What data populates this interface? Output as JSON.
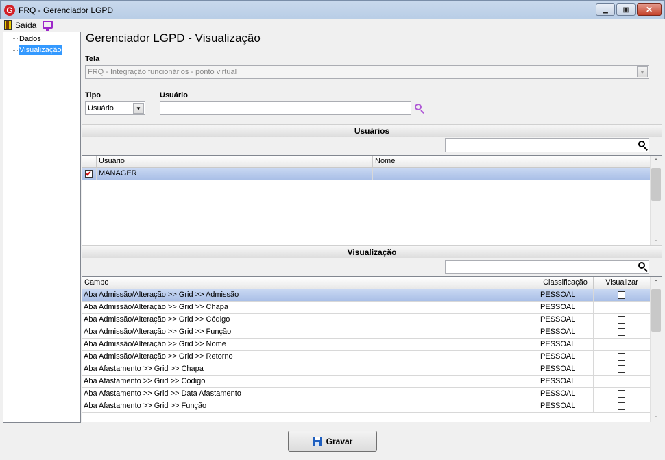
{
  "window": {
    "title": "FRQ - Gerenciador LGPD",
    "logo": "G"
  },
  "menu": {
    "exit_label": "Saída"
  },
  "tree": {
    "items": [
      "Dados",
      "Visualização"
    ]
  },
  "page_title": "Gerenciador LGPD - Visualização",
  "tela": {
    "label": "Tela",
    "value": "FRQ - Integração funcionários - ponto virtual"
  },
  "tipo": {
    "label": "Tipo",
    "value": "Usuário"
  },
  "usuario": {
    "label": "Usuário",
    "value": ""
  },
  "users_section": {
    "title": "Usuários",
    "search_value": "",
    "columns": [
      "Usuário",
      "Nome"
    ],
    "rows": [
      {
        "checked": true,
        "usuario": "MANAGER",
        "nome": ""
      }
    ]
  },
  "view_section": {
    "title": "Visualização",
    "search_value": "",
    "columns": [
      "Campo",
      "Classificação",
      "Visualizar"
    ],
    "rows": [
      {
        "campo": "Aba Admissão/Alteração >> Grid >> Admissão",
        "classificacao": "PESSOAL",
        "visualizar": false
      },
      {
        "campo": "Aba Admissão/Alteração >> Grid >> Chapa",
        "classificacao": "PESSOAL",
        "visualizar": false
      },
      {
        "campo": "Aba Admissão/Alteração >> Grid >> Código",
        "classificacao": "PESSOAL",
        "visualizar": false
      },
      {
        "campo": "Aba Admissão/Alteração >> Grid >> Função",
        "classificacao": "PESSOAL",
        "visualizar": false
      },
      {
        "campo": "Aba Admissão/Alteração >> Grid >> Nome",
        "classificacao": "PESSOAL",
        "visualizar": false
      },
      {
        "campo": "Aba Admissão/Alteração >> Grid >> Retorno",
        "classificacao": "PESSOAL",
        "visualizar": false
      },
      {
        "campo": "Aba Afastamento >> Grid >> Chapa",
        "classificacao": "PESSOAL",
        "visualizar": false
      },
      {
        "campo": "Aba Afastamento >> Grid >> Código",
        "classificacao": "PESSOAL",
        "visualizar": false
      },
      {
        "campo": "Aba Afastamento >> Grid >> Data Afastamento",
        "classificacao": "PESSOAL",
        "visualizar": false
      },
      {
        "campo": "Aba Afastamento >> Grid >> Função",
        "classificacao": "PESSOAL",
        "visualizar": false
      }
    ]
  },
  "save_button": {
    "label": "Gravar"
  },
  "colors": {
    "selection": "#3399ff",
    "row_selected": "#b5c9ec",
    "search_accent": "#b05ad6",
    "close_red": "#c4422b"
  }
}
